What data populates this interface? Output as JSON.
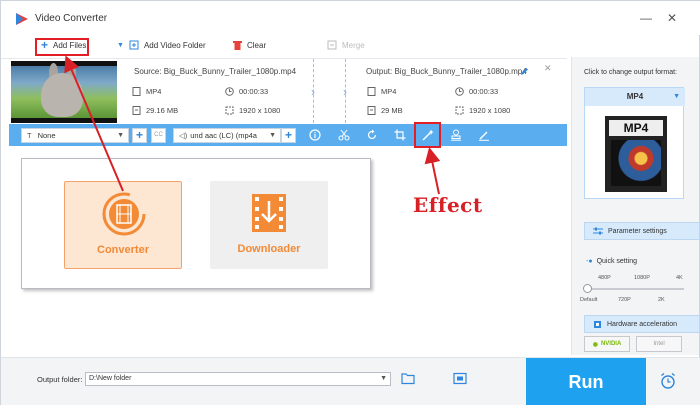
{
  "app": {
    "title": "Video Converter",
    "window_controls": {
      "minimize": "—",
      "close": "✕"
    }
  },
  "toolbar": {
    "add_files": "Add Files",
    "add_video_folder": "Add Video Folder",
    "clear": "Clear",
    "merge": "Merge"
  },
  "file": {
    "source": "Source: Big_Buck_Bunny_Trailer_1080p.mp4",
    "output": "Output: Big_Buck_Bunny_Trailer_1080p.mp4",
    "src_format": "MP4",
    "src_duration": "00:00:33",
    "src_size": "29.16 MB",
    "src_resolution": "1920 x 1080",
    "out_format": "MP4",
    "out_duration": "00:00:33",
    "out_size": "29 MB",
    "out_resolution": "1920 x 1080"
  },
  "editbar": {
    "subtitle_select": "None",
    "audio_select": "und aac (LC) (mp4a",
    "cc": "CC"
  },
  "modes": {
    "converter": "Converter",
    "downloader": "Downloader"
  },
  "annotation": {
    "effect": "Effect"
  },
  "rightpanel": {
    "hint": "Click to change output format:",
    "format": "MP4",
    "format_badge": "MP4",
    "parameter_settings": "Parameter settings",
    "quick_setting": "Quick setting",
    "ticks_top": [
      "480P",
      "1080P",
      "4K"
    ],
    "ticks_bottom": [
      "Default",
      "720P",
      "2K"
    ],
    "quality_level": 0,
    "hardware_acceleration": "Hardware acceleration",
    "nvidia": "NVIDIA",
    "intel": "Intel"
  },
  "bottom": {
    "output_folder_label": "Output folder:",
    "output_folder_value": "D:\\New folder",
    "run": "Run"
  },
  "colors": {
    "accent_blue": "#1ea2f0",
    "edit_bar": "#5aaef0",
    "annotation_red": "#d82027",
    "converter_orange": "#f28a36"
  }
}
